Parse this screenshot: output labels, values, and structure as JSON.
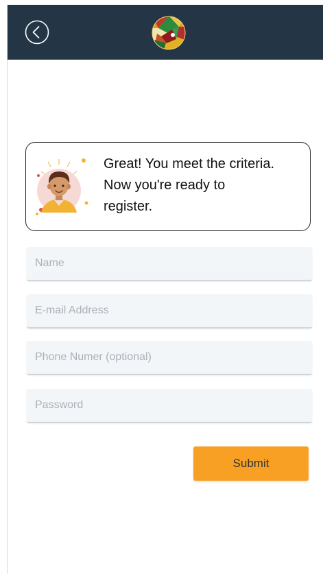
{
  "header": {
    "back_icon": "back-arrow-circle-icon",
    "logo_icon": "globe-logo-icon",
    "background_color": "#243545"
  },
  "message": {
    "line1": "Great! You meet the criteria.",
    "line2": "Now you're ready to",
    "line3": "register.",
    "avatar_icon": "smiling-person-avatar-icon"
  },
  "form": {
    "name_placeholder": "Name",
    "email_placeholder": "E-mail Address",
    "phone_placeholder": "Phone Numer (optional)",
    "password_placeholder": "Password",
    "submit_label": "Submit",
    "submit_color": "#f7a024"
  }
}
